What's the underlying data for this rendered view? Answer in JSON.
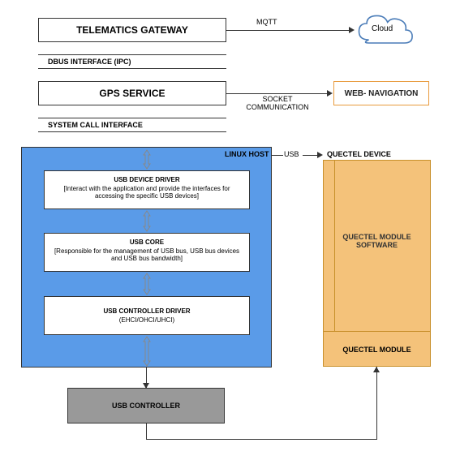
{
  "telematics": {
    "title": "TELEMATICS GATEWAY"
  },
  "mqtt": {
    "label": "MQTT"
  },
  "cloud": {
    "label": "Cloud"
  },
  "dbus": {
    "label": "DBUS INTERFACE (IPC)"
  },
  "gps": {
    "label": "GPS SERVICE"
  },
  "socket": {
    "label": "SOCKET COMMUNICATION"
  },
  "webnav": {
    "label": "WEB- NAVIGATION"
  },
  "syscall": {
    "label": "SYSTEM CALL INTERFACE"
  },
  "linux": {
    "label": "LINUX HOST"
  },
  "usb": {
    "label": "USB"
  },
  "quectel_device": {
    "label": "QUECTEL DEVICE"
  },
  "usb_device_driver": {
    "title": "USB DEVICE DRIVER",
    "desc": "[Interact with the application and provide the interfaces for accessing the specific USB devices]"
  },
  "usb_core": {
    "title": "USB CORE",
    "desc": "[Responsible for the management of USB bus, USB bus devices and USB bus bandwidth]"
  },
  "usb_controller_driver": {
    "title": "USB CONTROLLER DRIVER",
    "desc": "(EHCI/OHCI/UHCI)"
  },
  "quectel_module_sw": {
    "label": "QUECTEL MODULE SOFTWARE"
  },
  "quectel_module": {
    "label": "QUECTEL MODULE"
  },
  "usb_controller": {
    "label": "USB CONTROLLER"
  }
}
